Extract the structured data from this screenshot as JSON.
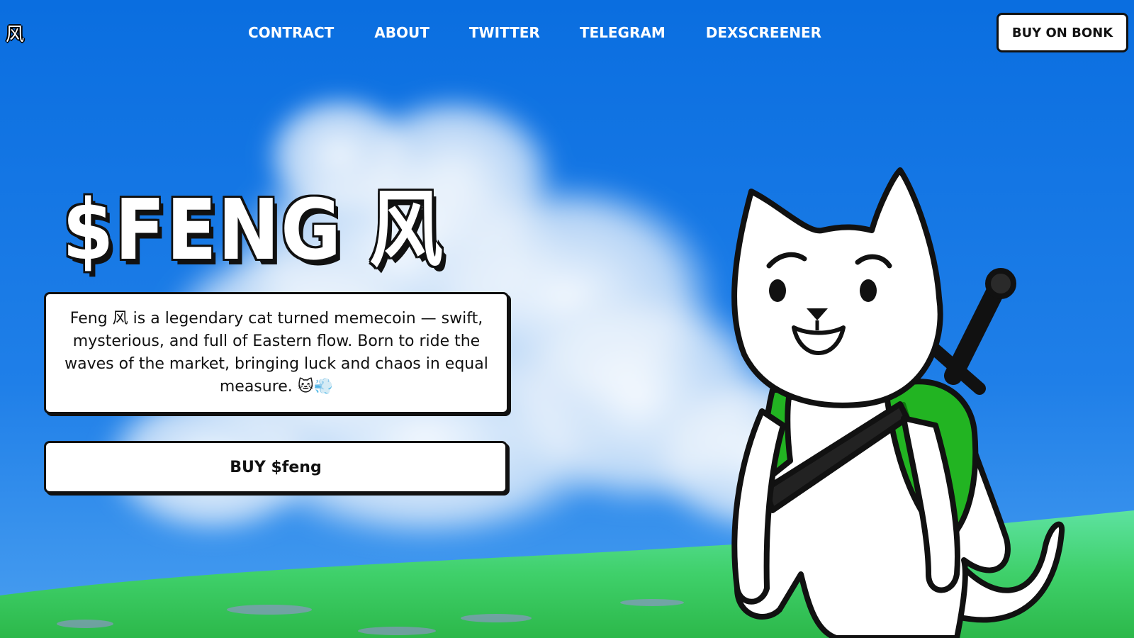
{
  "nav": {
    "logo": "风",
    "links": [
      "CONTRACT",
      "ABOUT",
      "TWITTER",
      "TELEGRAM",
      "DEXSCREENER"
    ],
    "cta_label": "BUY ON BONK"
  },
  "hero": {
    "title": "$FENG 风",
    "description": "Feng 风 is a legendary cat turned memecoin — swift, mysterious, and full of Eastern flow. Born to ride the waves of the market, bringing luck and chaos in equal measure. 🐱💨",
    "buy_label": "BUY $feng"
  },
  "colors": {
    "sky_top": "#0a6fe0",
    "sky_bottom": "#2f86ec",
    "grass": "#3fd36a",
    "backpack": "#22b422",
    "outline": "#111111"
  },
  "illustration": {
    "icon": "feng-cat-illustration"
  }
}
